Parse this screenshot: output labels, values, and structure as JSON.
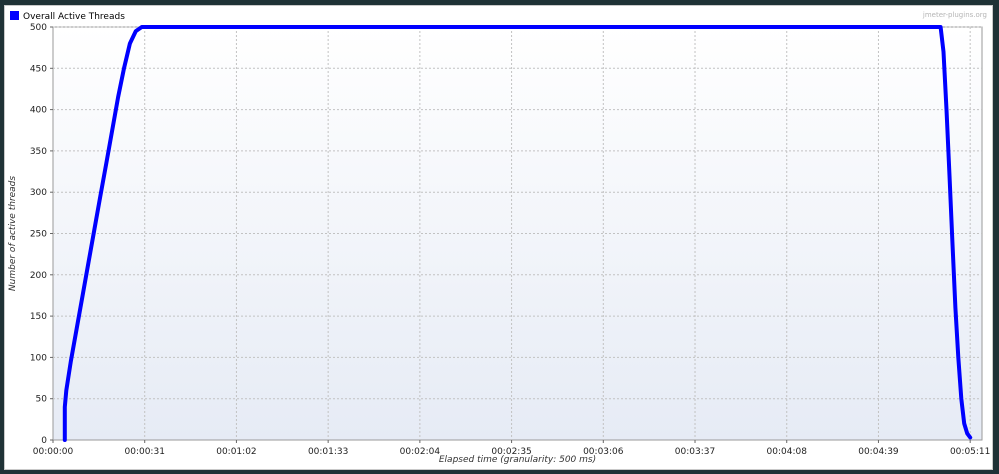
{
  "chart_data": {
    "type": "line",
    "title": "",
    "watermark": "jmeter-plugins.org",
    "xlabel": "Elapsed time (granularity: 500 ms)",
    "ylabel": "Number of active threads",
    "legend": {
      "placement": "top-left",
      "entries": [
        {
          "name": "Overall Active Threads",
          "color": "#0000ff"
        }
      ]
    },
    "grid": true,
    "xlim": [
      0,
      314
    ],
    "ylim": [
      0,
      500
    ],
    "x_ticks": [
      {
        "value": 0,
        "label": "00:00:00"
      },
      {
        "value": 31,
        "label": "00:00:31"
      },
      {
        "value": 62,
        "label": "00:01:02"
      },
      {
        "value": 93,
        "label": "00:01:33"
      },
      {
        "value": 124,
        "label": "00:02:04"
      },
      {
        "value": 155,
        "label": "00:02:35"
      },
      {
        "value": 186,
        "label": "00:03:06"
      },
      {
        "value": 217,
        "label": "00:03:37"
      },
      {
        "value": 248,
        "label": "00:04:08"
      },
      {
        "value": 279,
        "label": "00:04:39"
      },
      {
        "value": 310,
        "label": "00:05:11"
      }
    ],
    "y_ticks": [
      0,
      50,
      100,
      150,
      200,
      250,
      300,
      350,
      400,
      450,
      500
    ],
    "series": [
      {
        "name": "Overall Active Threads",
        "color": "#0000ff",
        "x": [
          4,
          4,
          4.5,
          6,
          8,
          10,
          12,
          14,
          16,
          18,
          20,
          22,
          24,
          26,
          28,
          30,
          31,
          300,
          301,
          302,
          303,
          304,
          305,
          306,
          307,
          308,
          309,
          310
        ],
        "y": [
          0,
          40,
          60,
          95,
          135,
          175,
          215,
          255,
          295,
          335,
          375,
          415,
          450,
          480,
          495,
          500,
          500,
          500,
          470,
          400,
          320,
          240,
          160,
          100,
          50,
          20,
          8,
          3
        ]
      }
    ]
  }
}
